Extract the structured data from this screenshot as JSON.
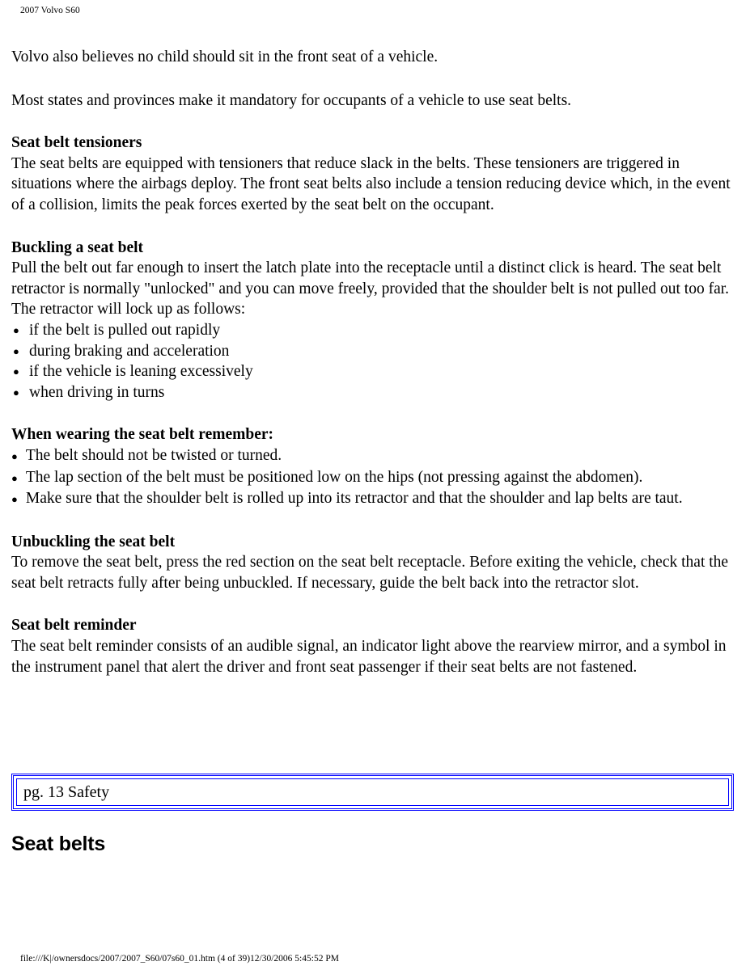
{
  "print_header": "2007 Volvo S60",
  "print_footer": "file:///K|/ownersdocs/2007/2007_S60/07s60_01.htm (4 of 39)12/30/2006 5:45:52 PM",
  "document": {
    "intro_paragraphs": [
      "Volvo also believes no child should sit in the front seat of a vehicle.",
      "Most states and provinces make it mandatory for occupants of a vehicle to use seat belts."
    ],
    "sections": [
      {
        "heading": "Seat belt tensioners",
        "body": "The seat belts are equipped with tensioners that reduce slack in the belts. These tensioners are triggered in situations where the airbags deploy. The front seat belts also include a tension reducing device which, in the event of a collision, limits the peak forces exerted by the seat belt on the occupant."
      },
      {
        "heading": "Buckling a seat belt",
        "body": "Pull the belt out far enough to insert the latch plate into the receptacle until a distinct click is heard. The seat belt retractor is normally \"unlocked\" and you can move freely, provided that the shoulder belt is not pulled out too far. The retractor will lock up as follows:",
        "bullets": [
          "if the belt is pulled out rapidly",
          "during braking and acceleration",
          "if the vehicle is leaning excessively",
          "when driving in turns"
        ]
      },
      {
        "heading": "When wearing the seat belt remember:",
        "bullets": [
          "The belt should not be twisted or turned.",
          "The lap section of the belt must be positioned low on the hips (not pressing against the abdomen).",
          "Make sure that the shoulder belt is rolled up into its retractor and that the shoulder and lap belts are taut."
        ]
      },
      {
        "heading": "Unbuckling the seat belt",
        "body": "To remove the seat belt, press the red section on the seat belt receptacle. Before exiting the vehicle, check that the seat belt retracts fully after being unbuckled. If necessary, guide the belt back into the retractor slot."
      },
      {
        "heading": "Seat belt reminder",
        "body": "The seat belt reminder consists of an audible signal, an indicator light above the rearview mirror, and a symbol in the instrument panel that alert the driver and front seat passenger if their seat belts are not fastened."
      }
    ]
  },
  "nav_box": {
    "label": "pg. 13 Safety",
    "border_color": "#0000ff"
  },
  "page_heading": "Seat belts",
  "bullet_glyph": "●"
}
